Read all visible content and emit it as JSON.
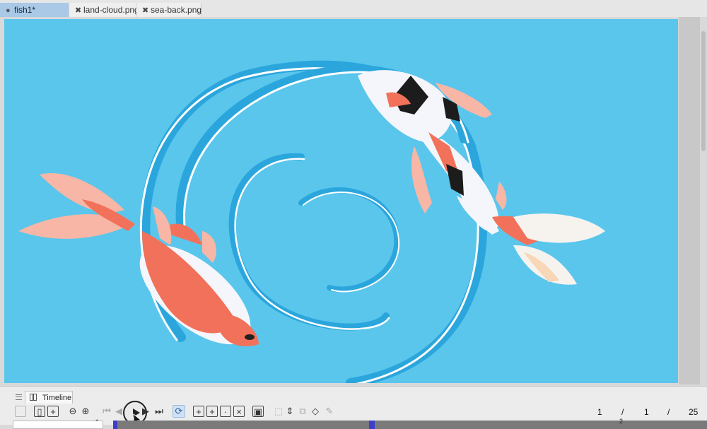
{
  "tabs": [
    {
      "label": "fish1*",
      "active": true,
      "icon": "dot-icon"
    },
    {
      "label": "land-cloud.png",
      "active": false,
      "icon": "close-icon"
    },
    {
      "label": "sea-back.png",
      "active": false,
      "icon": "close-icon"
    }
  ],
  "canvas": {
    "background": "#5ac6ec",
    "description_icon": "koi-artwork"
  },
  "panel": {
    "tab_label": "Timeline",
    "menu_icon": "hamburger-icon",
    "toolbar": [
      "layer-icon",
      "frame-view-icon",
      "add-frame-icon",
      "zoom-out-icon",
      "zoom-in-icon",
      "first-frame-icon",
      "prev-frame-icon",
      "play-icon",
      "next-frame-icon",
      "last-frame-icon",
      "loop-icon",
      "new-cel-icon",
      "insert-cel-icon",
      "cel-options-icon",
      "cel-delete-icon",
      "onion-skin-icon",
      "up-down-icon",
      "transform-icon",
      "cel-copy-icon",
      "path-icon",
      "pen-icon"
    ],
    "counter": {
      "current": "1",
      "sep1": "/",
      "fps": "1",
      "sep2": "/",
      "total": "25"
    },
    "timeline_frame_label": "2"
  }
}
